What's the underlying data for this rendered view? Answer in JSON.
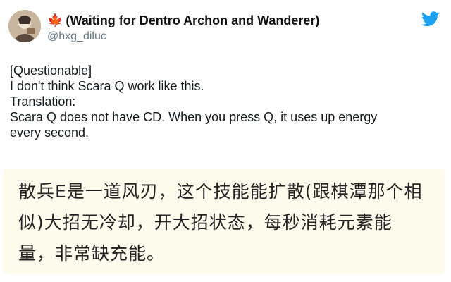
{
  "tweet": {
    "author": {
      "flag_icon": "maple-leaf-icon",
      "flag_glyph": "🍁",
      "display_name": "(Waiting for Dentro Archon and Wanderer)",
      "handle": "@hxg_diluc"
    },
    "brand_icon": "twitter-bird-icon",
    "body_lines": [
      "[Questionable]",
      "I don't think Scara Q work like this.",
      "Translation:",
      "Scara Q does not have CD. When you press Q, it uses up energy",
      "every second."
    ],
    "quoted_image_lines": [
      "散兵E是一道风刃，这个技能能扩散(跟棋潭那个相",
      "似)大招无冷却，开大招状态，每秒消耗元素能",
      "量，非常缺充能。"
    ],
    "colors": {
      "brand_blue": "#1da1f2",
      "handle_gray": "#657786",
      "quote_background": "#fdfbec",
      "flag_red": "#d62828"
    }
  }
}
